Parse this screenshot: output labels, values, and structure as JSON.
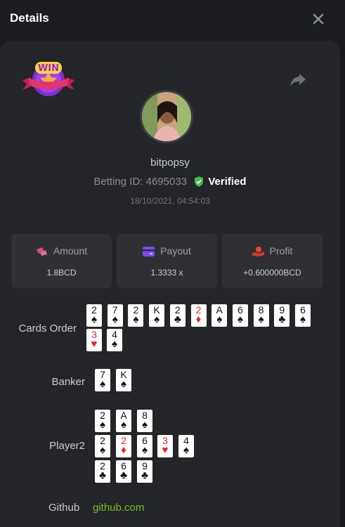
{
  "header": {
    "title": "Details"
  },
  "badge": {
    "text": "WIN"
  },
  "user": {
    "name": "bitpopsy",
    "betting_id_label": "Betting ID: 4695033",
    "verified_label": "Verified",
    "timestamp": "18/10/2021, 04:54:03"
  },
  "stats": {
    "amount": {
      "label": "Amount",
      "value": "1.8BCD"
    },
    "payout": {
      "label": "Payout",
      "value": "1.3333 x"
    },
    "profit": {
      "label": "Profit",
      "value": "+0.600000BCD"
    }
  },
  "colors": {
    "accent_green": "#7dbb1f",
    "verified_green": "#3fbf4a",
    "card_red": "#e3262d"
  },
  "cards_order": {
    "label": "Cards Order",
    "cards": [
      {
        "rank": "2",
        "suit": "♠"
      },
      {
        "rank": "7",
        "suit": "♠"
      },
      {
        "rank": "2",
        "suit": "♠"
      },
      {
        "rank": "K",
        "suit": "♠"
      },
      {
        "rank": "2",
        "suit": "♣"
      },
      {
        "rank": "2",
        "suit": "♦"
      },
      {
        "rank": "A",
        "suit": "♠"
      },
      {
        "rank": "6",
        "suit": "♠"
      },
      {
        "rank": "8",
        "suit": "♠"
      },
      {
        "rank": "9",
        "suit": "♣"
      },
      {
        "rank": "6",
        "suit": "♠"
      },
      {
        "rank": "3",
        "suit": "♥"
      },
      {
        "rank": "4",
        "suit": "♠"
      }
    ]
  },
  "banker": {
    "label": "Banker",
    "cards": [
      {
        "rank": "7",
        "suit": "♠"
      },
      {
        "rank": "K",
        "suit": "♠"
      }
    ]
  },
  "player2": {
    "label": "Player2",
    "cards": [
      {
        "rank": "2",
        "suit": "♠"
      },
      {
        "rank": "A",
        "suit": "♠"
      },
      {
        "rank": "8",
        "suit": "♠"
      },
      {
        "rank": "2",
        "suit": "♠"
      },
      {
        "rank": "2",
        "suit": "♦"
      },
      {
        "rank": "6",
        "suit": "♠"
      },
      {
        "rank": "3",
        "suit": "♥"
      },
      {
        "rank": "4",
        "suit": "♠"
      },
      {
        "rank": "2",
        "suit": "♣"
      },
      {
        "rank": "6",
        "suit": "♣"
      },
      {
        "rank": "9",
        "suit": "♣"
      }
    ]
  },
  "github": {
    "label": "Github",
    "link_text": "github.com"
  }
}
